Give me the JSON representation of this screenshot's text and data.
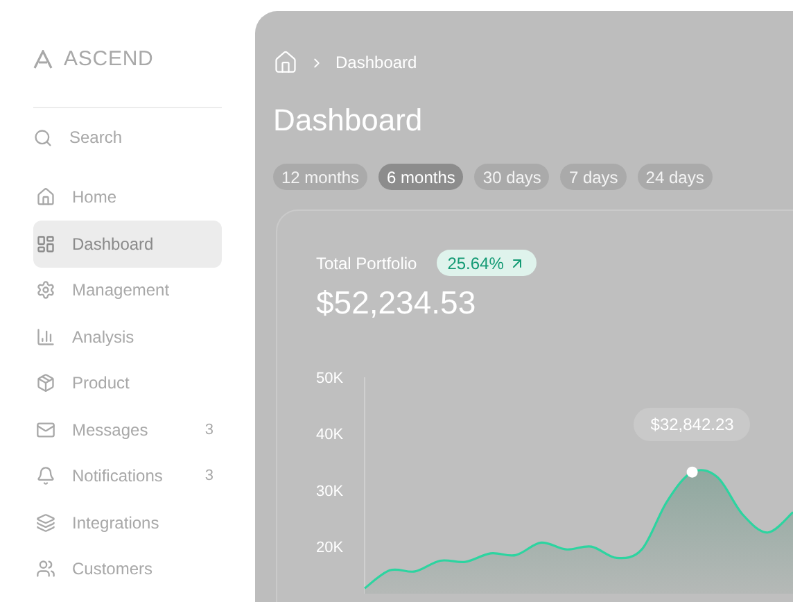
{
  "sidebar": {
    "logo": "ASCEND",
    "search": {
      "placeholder": "Search"
    },
    "items": [
      {
        "label": "Home",
        "selected": false
      },
      {
        "label": "Dashboard",
        "selected": true
      },
      {
        "label": "Management",
        "selected": false
      },
      {
        "label": "Analysis",
        "selected": false
      },
      {
        "label": "Product",
        "selected": false
      },
      {
        "label": "Messages",
        "selected": false,
        "badge": "3"
      },
      {
        "label": "Notifications",
        "selected": false,
        "badge": "3"
      },
      {
        "label": "Integrations",
        "selected": false
      },
      {
        "label": "Customers",
        "selected": false
      }
    ]
  },
  "main": {
    "breadcrumb": [
      "Dashboard"
    ],
    "title": "Dashboard",
    "tabs": [
      {
        "label": "12 months",
        "selected": false
      },
      {
        "label": "6 months",
        "selected": true
      },
      {
        "label": "30 days",
        "selected": false
      },
      {
        "label": "7 days",
        "selected": false
      },
      {
        "label": "24 days",
        "selected": false
      }
    ],
    "portfolio": {
      "label": "Total Portfolio",
      "value": "$52,234.53",
      "change": "25.64%",
      "chart_data": {
        "type": "area",
        "ylim": [
          12000,
          50000
        ],
        "yticks": [
          {
            "value": 20000,
            "label": "20K"
          },
          {
            "value": 30000,
            "label": "30K"
          },
          {
            "value": 40000,
            "label": "40K"
          },
          {
            "value": 50000,
            "label": "50K"
          }
        ],
        "series": [
          {
            "color": "#2dd4a0",
            "values": [
              12600,
              15800,
              15600,
              17500,
              17300,
              18800,
              18500,
              20700,
              19500,
              20000,
              18000,
              19500,
              28000,
              33200,
              32300,
              25700,
              22500,
              26100
            ]
          }
        ],
        "annotations": [
          {
            "text": "$32,842.23",
            "y": 33200
          }
        ]
      }
    }
  }
}
